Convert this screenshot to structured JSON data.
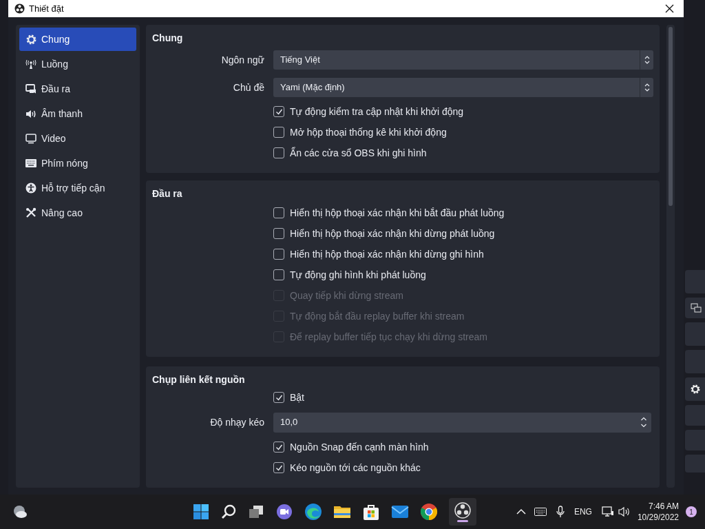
{
  "window": {
    "title": "Thiết đặt"
  },
  "sidebar": {
    "items": [
      {
        "label": "Chung",
        "selected": true
      },
      {
        "label": "Luồng",
        "selected": false
      },
      {
        "label": "Đầu ra",
        "selected": false
      },
      {
        "label": "Âm thanh",
        "selected": false
      },
      {
        "label": "Video",
        "selected": false
      },
      {
        "label": "Phím nóng",
        "selected": false
      },
      {
        "label": "Hỗ trợ tiếp cận",
        "selected": false
      },
      {
        "label": "Nâng cao",
        "selected": false
      }
    ]
  },
  "sections": [
    {
      "title": "Chung",
      "rows": [
        {
          "kind": "combo",
          "label": "Ngôn ngữ",
          "value": "Tiếng Việt"
        },
        {
          "kind": "combo",
          "label": "Chủ đề",
          "value": "Yami (Mặc định)"
        },
        {
          "kind": "checkbox",
          "label": "Tự động kiểm tra cập nhật khi khởi động",
          "checked": true,
          "disabled": false
        },
        {
          "kind": "checkbox",
          "label": "Mở hộp thoại thống kê khi khởi động",
          "checked": false,
          "disabled": false
        },
        {
          "kind": "checkbox",
          "label": "Ẩn các cửa sổ OBS khi ghi hình",
          "checked": false,
          "disabled": false
        }
      ]
    },
    {
      "title": "Đầu ra",
      "rows": [
        {
          "kind": "checkbox",
          "label": "Hiển thị hộp thoại xác nhận khi bắt đầu phát luồng",
          "checked": false,
          "disabled": false
        },
        {
          "kind": "checkbox",
          "label": "Hiển thị hộp thoại xác nhận khi dừng phát luồng",
          "checked": false,
          "disabled": false
        },
        {
          "kind": "checkbox",
          "label": "Hiển thị hộp thoại xác nhận khi dừng ghi hình",
          "checked": false,
          "disabled": false
        },
        {
          "kind": "checkbox",
          "label": "Tự động ghi hình khi phát luồng",
          "checked": false,
          "disabled": false
        },
        {
          "kind": "checkbox",
          "label": "Quay tiếp khi dừng stream",
          "checked": false,
          "disabled": true
        },
        {
          "kind": "checkbox",
          "label": "Tự động bắt đầu replay buffer khi stream",
          "checked": false,
          "disabled": true
        },
        {
          "kind": "checkbox",
          "label": "Để replay buffer tiếp tục chạy khi dừng stream",
          "checked": false,
          "disabled": true
        }
      ]
    },
    {
      "title": "Chụp liên kết nguồn",
      "rows": [
        {
          "kind": "checkbox",
          "label": "Bật",
          "checked": true,
          "disabled": false
        },
        {
          "kind": "spin",
          "label": "Độ nhạy kéo",
          "value": "10,0"
        },
        {
          "kind": "checkbox",
          "label": "Nguồn Snap đến cạnh màn hình",
          "checked": true,
          "disabled": false
        },
        {
          "kind": "checkbox",
          "label": "Kéo nguồn tới các nguồn khác",
          "checked": true,
          "disabled": false
        }
      ]
    }
  ],
  "taskbar": {
    "language": "ENG",
    "time": "7:46 AM",
    "date": "10/29/2022",
    "notifications": "1"
  }
}
